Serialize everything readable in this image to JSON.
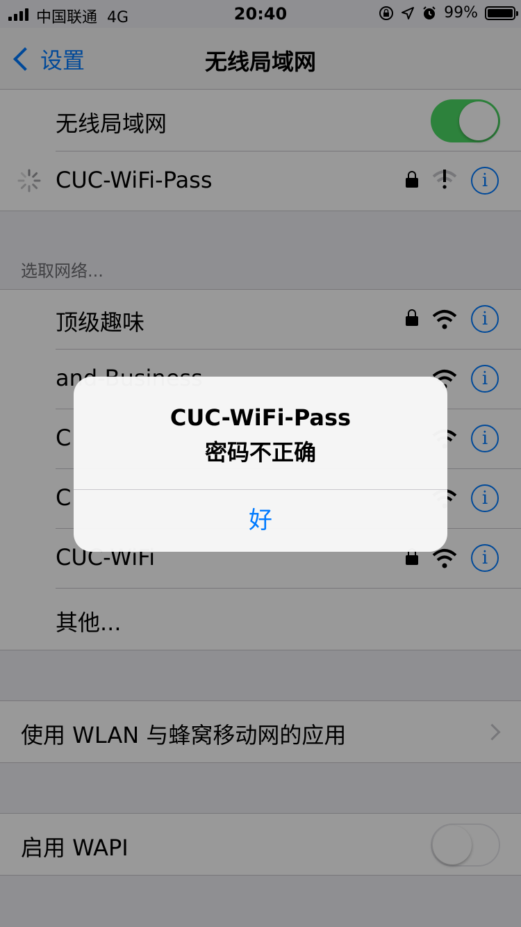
{
  "status_bar": {
    "carrier": "中国联通",
    "network": "4G",
    "time": "20:40",
    "battery": "99%"
  },
  "nav": {
    "back_label": "设置",
    "title": "无线局域网"
  },
  "wifi_group": {
    "toggle_label": "无线局域网",
    "toggle_on": true,
    "connecting_network": "CUC-WiFi-Pass"
  },
  "networks_header": "选取网络...",
  "networks": [
    {
      "name": "顶级趣味",
      "locked": true
    },
    {
      "name": "and-Business",
      "locked": false
    },
    {
      "name": "C",
      "locked": false
    },
    {
      "name": "C",
      "locked": false
    },
    {
      "name": "CUC-WiFi",
      "locked": true
    }
  ],
  "other_label": "其他...",
  "apps_label": "使用 WLAN 与蜂窝移动网的应用",
  "wapi_label": "启用 WAPI",
  "wapi_on": false,
  "alert": {
    "title": "CUC-WiFi-Pass",
    "message": "密码不正确",
    "ok": "好"
  },
  "colors": {
    "accent": "#007aff",
    "toggle_on": "#4cd964"
  },
  "icons": [
    "signal-icon",
    "location-icon",
    "alarm-icon",
    "lock-rotation-icon",
    "battery-icon",
    "chevron-left-icon",
    "lock-icon",
    "wifi-icon",
    "wifi-error-icon",
    "info-icon",
    "spinner-icon",
    "chevron-right-icon"
  ]
}
